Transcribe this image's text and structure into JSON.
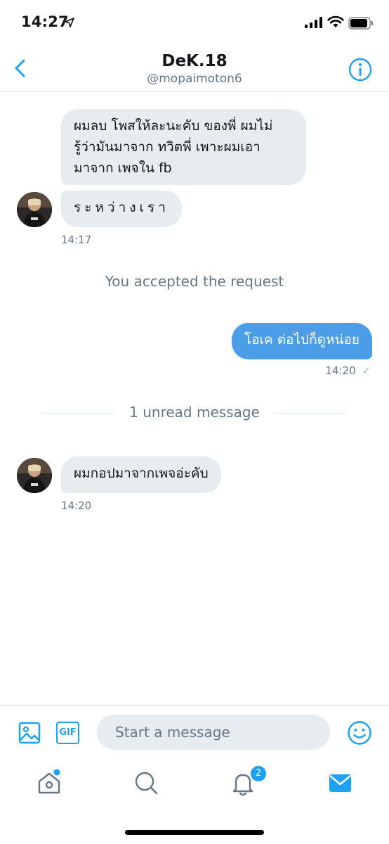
{
  "status_bar": {
    "time": "14:27"
  },
  "header": {
    "name": "DeK.18",
    "handle": "@mopaimoton6"
  },
  "messages": [
    {
      "text": "ผมลบ โพสให้ละนะคับ ของพี่ ผมไม่รู้ว่ามันมาจาก ทวิตพี่ เพาะผมเอามาจาก เพจใน fb",
      "lines": [
        "ผมลบ โพสให้ละนะคับ ของพี่ ผมไม่",
        "รู้ว่ามันมาจาก ทวิตพี่ เพาะผมเอา",
        "มาจาก เพจใน fb"
      ]
    },
    {
      "text": "ระหว่างเรา"
    },
    {
      "timestamp": "14:17"
    },
    {
      "system": "You accepted the request"
    },
    {
      "text": "โอเค ต่อไปก็ดูหน่อย",
      "timestamp": "14:20",
      "read_mark": "✓"
    },
    {
      "divider": "1 unread message"
    },
    {
      "text": "ผมกอปมาจากเพจอ่ะคับ",
      "timestamp": "14:20"
    }
  ],
  "composer": {
    "placeholder": "Start a message",
    "gif_label": "GIF"
  },
  "tabbar": {
    "notification_count": "2"
  },
  "colors": {
    "accent": "#1da1f2",
    "outgoing_bubble": "#4a9de6",
    "incoming_bubble": "#e6ecf0",
    "secondary_text": "#657786"
  }
}
